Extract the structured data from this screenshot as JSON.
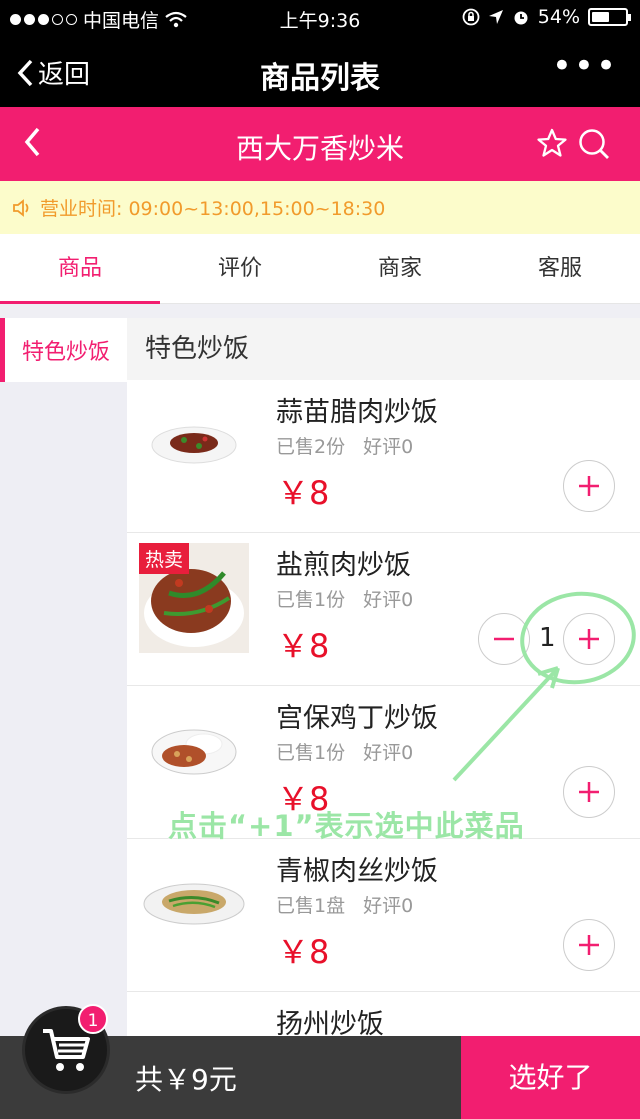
{
  "statusbar": {
    "carrier": "中国电信",
    "time": "上午9:36",
    "battery": "54%",
    "battery_level": 0.54
  },
  "nav": {
    "back": "返回",
    "title": "商品列表",
    "more": "•••"
  },
  "shop": {
    "name": "西大万香炒米"
  },
  "notice": {
    "text": "营业时间: 09:00~13:00,15:00~18:30"
  },
  "tabs": [
    {
      "label": "商品"
    },
    {
      "label": "评价"
    },
    {
      "label": "商家"
    },
    {
      "label": "客服"
    }
  ],
  "sidebar": {
    "items": [
      {
        "label": "特色炒饭"
      }
    ]
  },
  "category": {
    "title": "特色炒饭"
  },
  "products": [
    {
      "name": "蒜苗腊肉炒饭",
      "sold": "已售2份",
      "rating": "好评0",
      "price": "￥8"
    },
    {
      "name": "盐煎肉炒饭",
      "sold": "已售1份",
      "rating": "好评0",
      "price": "￥8",
      "badge": "热卖",
      "qty": "1"
    },
    {
      "name": "宫保鸡丁炒饭",
      "sold": "已售1份",
      "rating": "好评0",
      "price": "￥8"
    },
    {
      "name": "青椒肉丝炒饭",
      "sold": "已售1盘",
      "rating": "好评0",
      "price": "￥8"
    },
    {
      "name": "扬州炒饭"
    }
  ],
  "annotation": {
    "text": "点击“+1”表示选中此菜品"
  },
  "cart": {
    "badge": "1",
    "total": "共￥9元",
    "confirm": "选好了"
  },
  "colors": {
    "accent": "#f21e70",
    "price": "#e8102a",
    "notice_bg": "#fcfccb",
    "annotation": "#9be6a6"
  }
}
